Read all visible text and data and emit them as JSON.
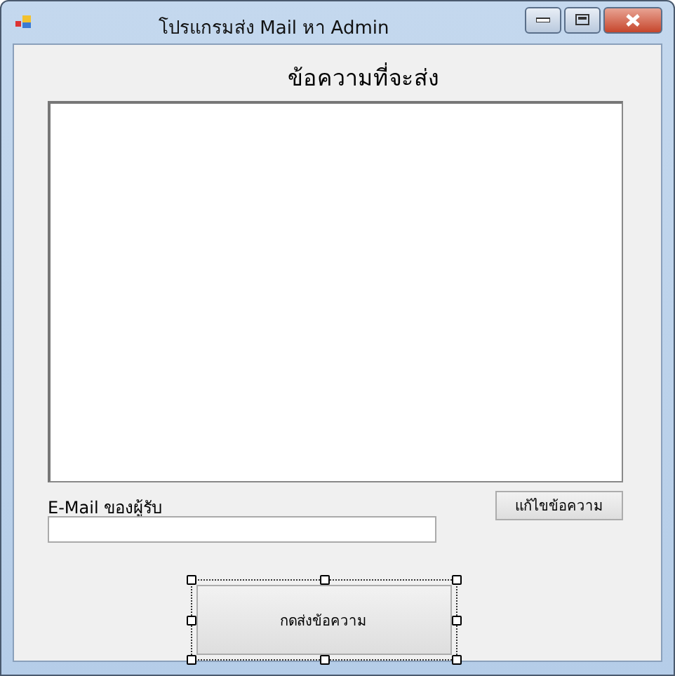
{
  "window": {
    "title": "โปรแกรมส่ง Mail หา Admin"
  },
  "heading": "ข้อความที่จะส่ง",
  "email": {
    "label": "E-Mail ของผู้รับ"
  },
  "edit_button": {
    "label": "แก้ไขข้อความ",
    "selected": false
  },
  "send_button": {
    "label": "กดส่งข้อความ",
    "selected": true
  }
}
